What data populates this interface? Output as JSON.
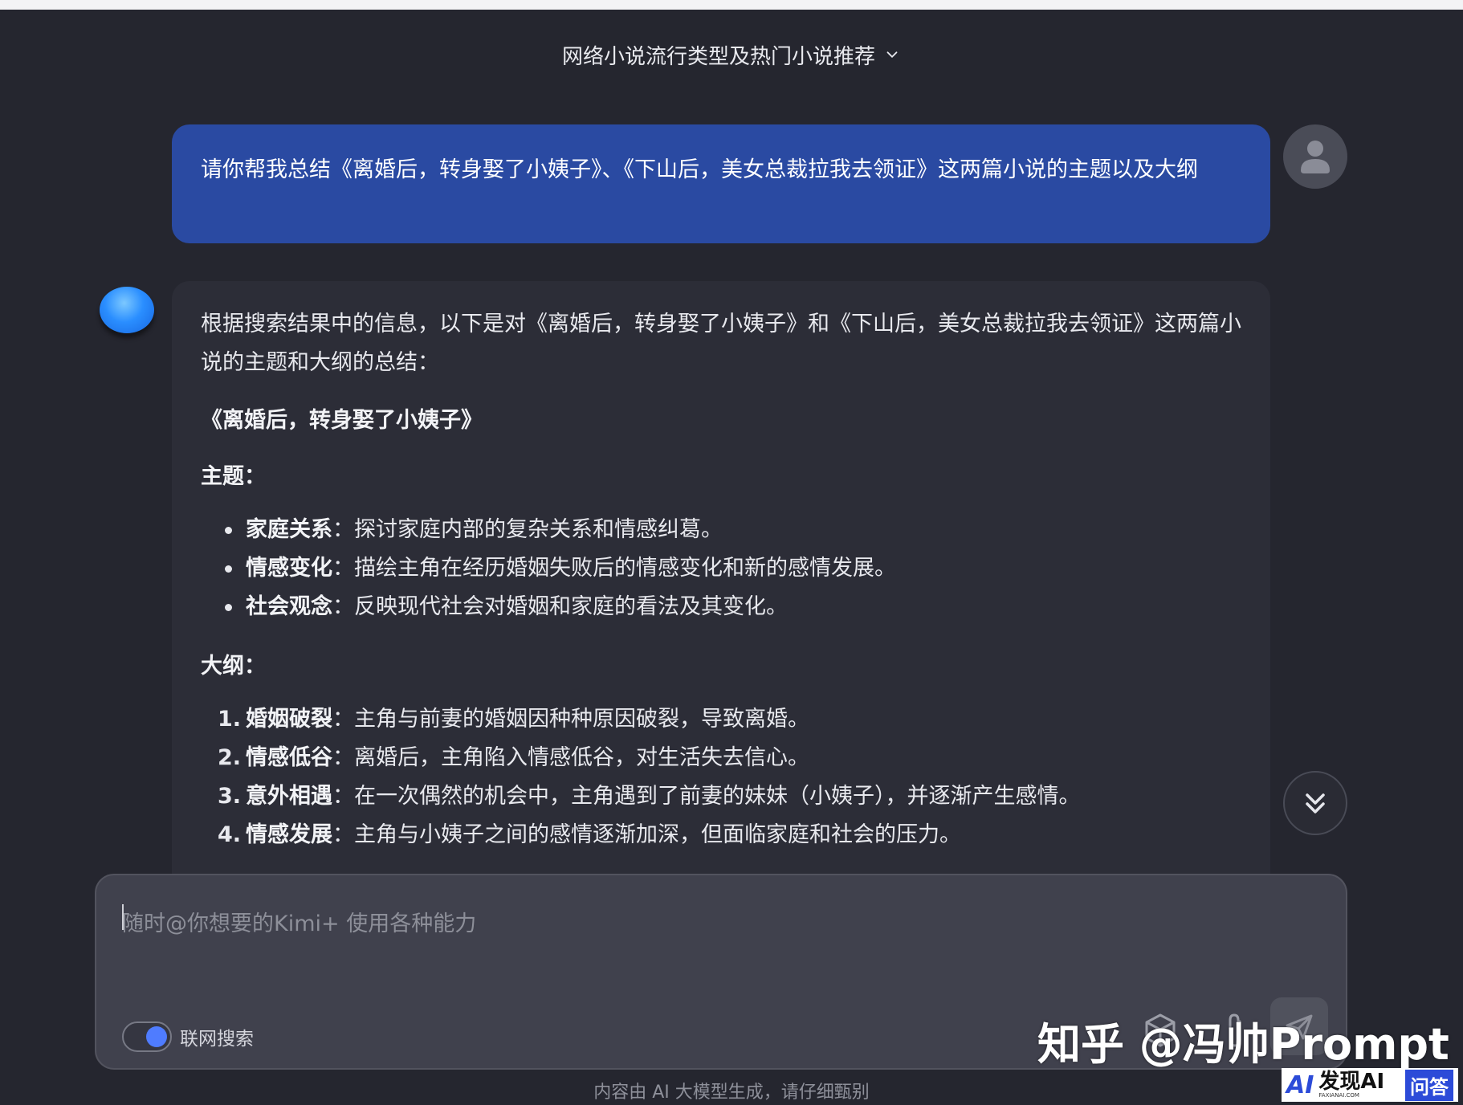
{
  "header": {
    "title": "网络小说流行类型及热门小说推荐"
  },
  "user_message": "请你帮我总结《离婚后，转身娶了小姨子》、《下山后，美女总裁拉我去领证》这两篇小说的主题以及大纲",
  "assistant": {
    "intro": "根据搜索结果中的信息，以下是对《离婚后，转身娶了小姨子》和《下山后，美女总裁拉我去领证》这两篇小说的主题和大纲的总结：",
    "novel_title": "《离婚后，转身娶了小姨子》",
    "theme_heading": "主题：",
    "themes": [
      {
        "term": "家庭关系",
        "sep": "：",
        "desc": "探讨家庭内部的复杂关系和情感纠葛。"
      },
      {
        "term": "情感变化",
        "sep": "：",
        "desc": "描绘主角在经历婚姻失败后的情感变化和新的感情发展。"
      },
      {
        "term": "社会观念",
        "sep": "：",
        "desc": "反映现代社会对婚姻和家庭的看法及其变化。"
      }
    ],
    "outline_heading": "大纲：",
    "outline": [
      {
        "num": "1.",
        "term": "婚姻破裂",
        "sep": "：",
        "desc": "主角与前妻的婚姻因种种原因破裂，导致离婚。"
      },
      {
        "num": "2.",
        "term": "情感低谷",
        "sep": "：",
        "desc": "离婚后，主角陷入情感低谷，对生活失去信心。"
      },
      {
        "num": "3.",
        "term": "意外相遇",
        "sep": "：",
        "desc": "在一次偶然的机会中，主角遇到了前妻的妹妹（小姨子），并逐渐产生感情。"
      },
      {
        "num": "4.",
        "term": "情感发展",
        "sep": "：",
        "desc": "主角与小姨子之间的感情逐渐加深，但面临家庭和社会的压力。"
      }
    ]
  },
  "composer": {
    "placeholder": "随时@你想要的Kimi+ 使用各种能力",
    "web_search_label": "联网搜索",
    "web_search_on": true
  },
  "disclaimer": "内容由 AI 大模型生成，请仔细甄别",
  "watermark": "知乎 @冯帅Prompt",
  "badge": {
    "ai": "AI",
    "name": "发现AI",
    "domain": "FAXIANAI.COM",
    "wenda": "问答"
  },
  "colors": {
    "user_bubble": "#2a4aa2",
    "accent": "#4f7cff",
    "background": "#25262f"
  }
}
